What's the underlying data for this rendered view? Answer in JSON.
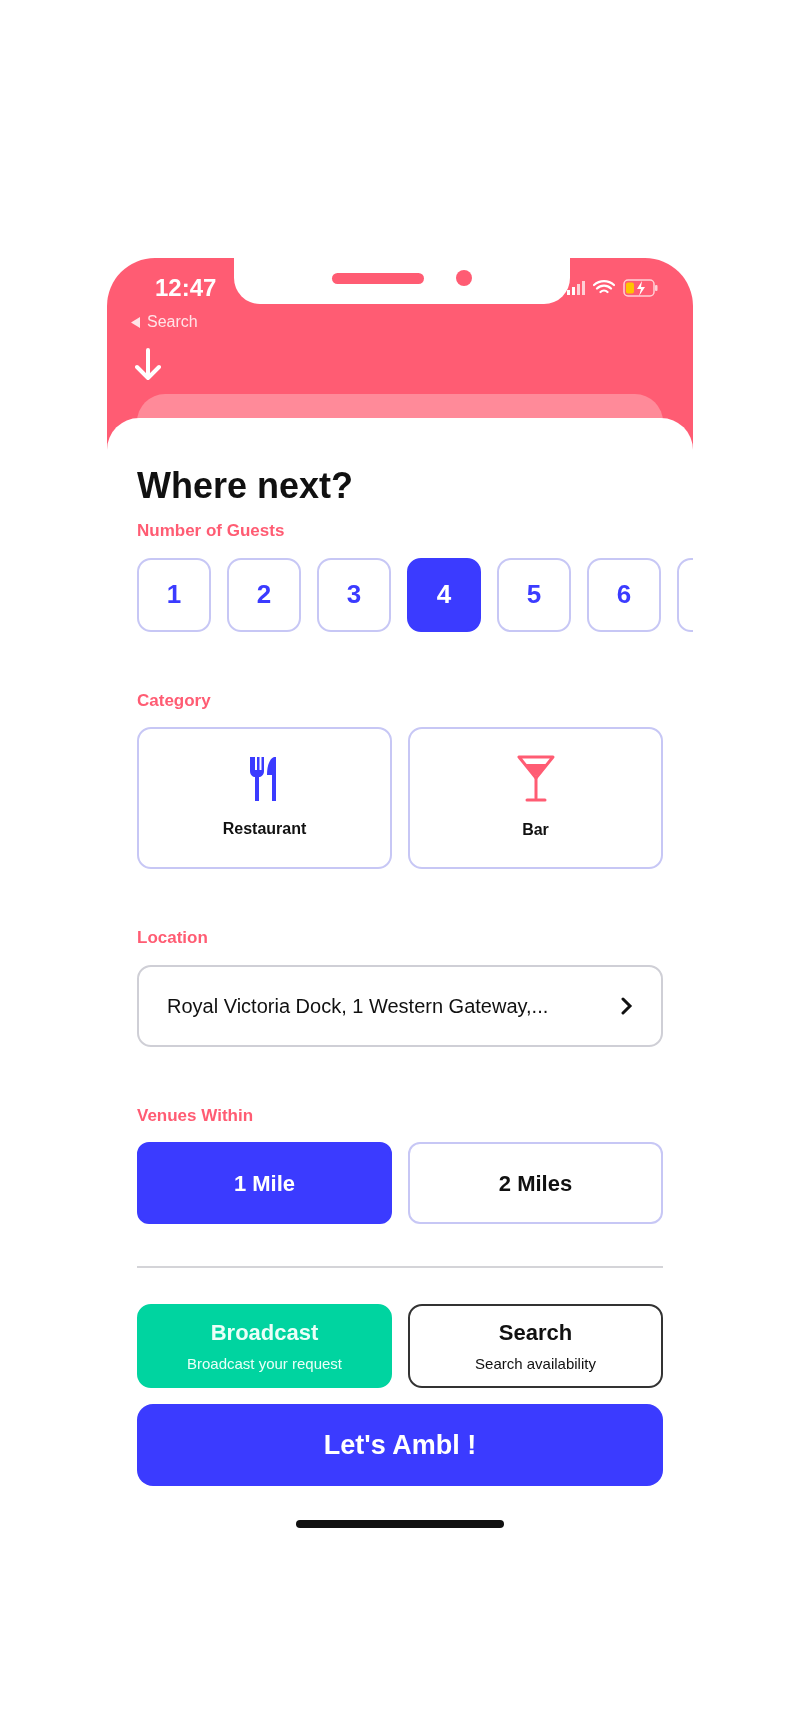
{
  "status_bar": {
    "time": "12:47",
    "back_label": "Search"
  },
  "title": "Where next?",
  "guests": {
    "label": "Number of Guests",
    "options": [
      {
        "label": "1",
        "selected": false
      },
      {
        "label": "2",
        "selected": false
      },
      {
        "label": "3",
        "selected": false
      },
      {
        "label": "4",
        "selected": true
      },
      {
        "label": "5",
        "selected": false
      },
      {
        "label": "6",
        "selected": false
      }
    ]
  },
  "category": {
    "label": "Category",
    "options": [
      {
        "label": "Restaurant",
        "kind": "cutlery",
        "selected": false
      },
      {
        "label": "Bar",
        "kind": "cocktail",
        "selected": false
      }
    ]
  },
  "location": {
    "label": "Location",
    "value": "Royal Victoria Dock, 1 Western Gateway,..."
  },
  "venues_within": {
    "label": "Venues Within",
    "options": [
      {
        "label": "1 Mile",
        "selected": true
      },
      {
        "label": "2 Miles",
        "selected": false
      }
    ]
  },
  "modes": [
    {
      "title": "Broadcast",
      "subtitle": "Broadcast your request",
      "selected": true
    },
    {
      "title": "Search",
      "subtitle": "Search availability",
      "selected": false
    }
  ],
  "primary_button": "Let's Ambl !"
}
